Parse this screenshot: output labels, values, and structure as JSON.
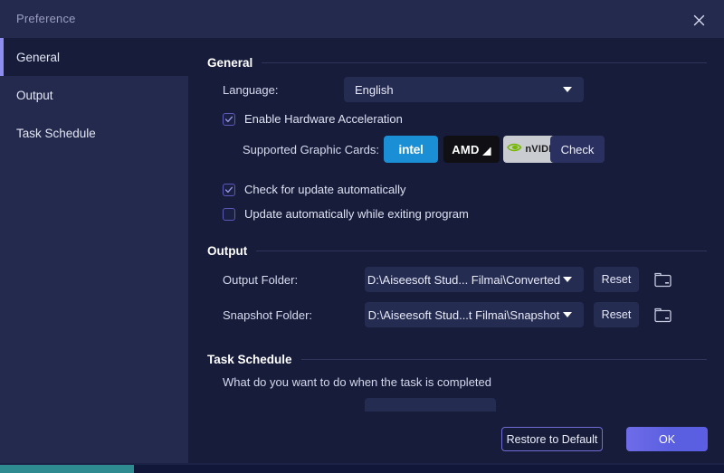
{
  "window": {
    "title": "Preference",
    "close_icon": "close-icon"
  },
  "sidebar": {
    "items": [
      {
        "label": "General",
        "selected": true
      },
      {
        "label": "Output",
        "selected": false
      },
      {
        "label": "Task Schedule",
        "selected": false
      }
    ]
  },
  "general": {
    "section_title": "General",
    "language_label": "Language:",
    "language_value": "English",
    "hardware_acceleration": {
      "label": "Enable Hardware Acceleration",
      "checked": true
    },
    "graphic_cards_label": "Supported Graphic Cards:",
    "cards": [
      {
        "name": "intel",
        "icon": "intel-logo-icon"
      },
      {
        "name": "AMD",
        "icon": "amd-logo-icon"
      },
      {
        "name": "nVIDIA",
        "icon": "nvidia-logo-icon"
      }
    ],
    "check_button": "Check",
    "check_update": {
      "label": "Check for update automatically",
      "checked": true
    },
    "update_on_exit": {
      "label": "Update automatically while exiting program",
      "checked": false
    }
  },
  "output": {
    "section_title": "Output",
    "output_folder_label": "Output Folder:",
    "output_folder_value": "D:\\Aiseesoft Stud... Filmai\\Converted",
    "snapshot_folder_label": "Snapshot Folder:",
    "snapshot_folder_value": "D:\\Aiseesoft Stud...t Filmai\\Snapshot",
    "reset_label": "Reset",
    "browse_icon": "folder-icon"
  },
  "task_schedule": {
    "section_title": "Task Schedule",
    "prompt": "What do you want to do when the task is completed",
    "action_value": ""
  },
  "footer": {
    "restore_label": "Restore to Default",
    "ok_label": "OK"
  },
  "colors": {
    "accent": "#8d8cf0",
    "ok_button": "#5f62e4",
    "titlebar_bg": "#242a4d",
    "content_bg": "#161c3a",
    "intel_blue": "#1b8fd6",
    "nvidia_green": "#76b900"
  }
}
